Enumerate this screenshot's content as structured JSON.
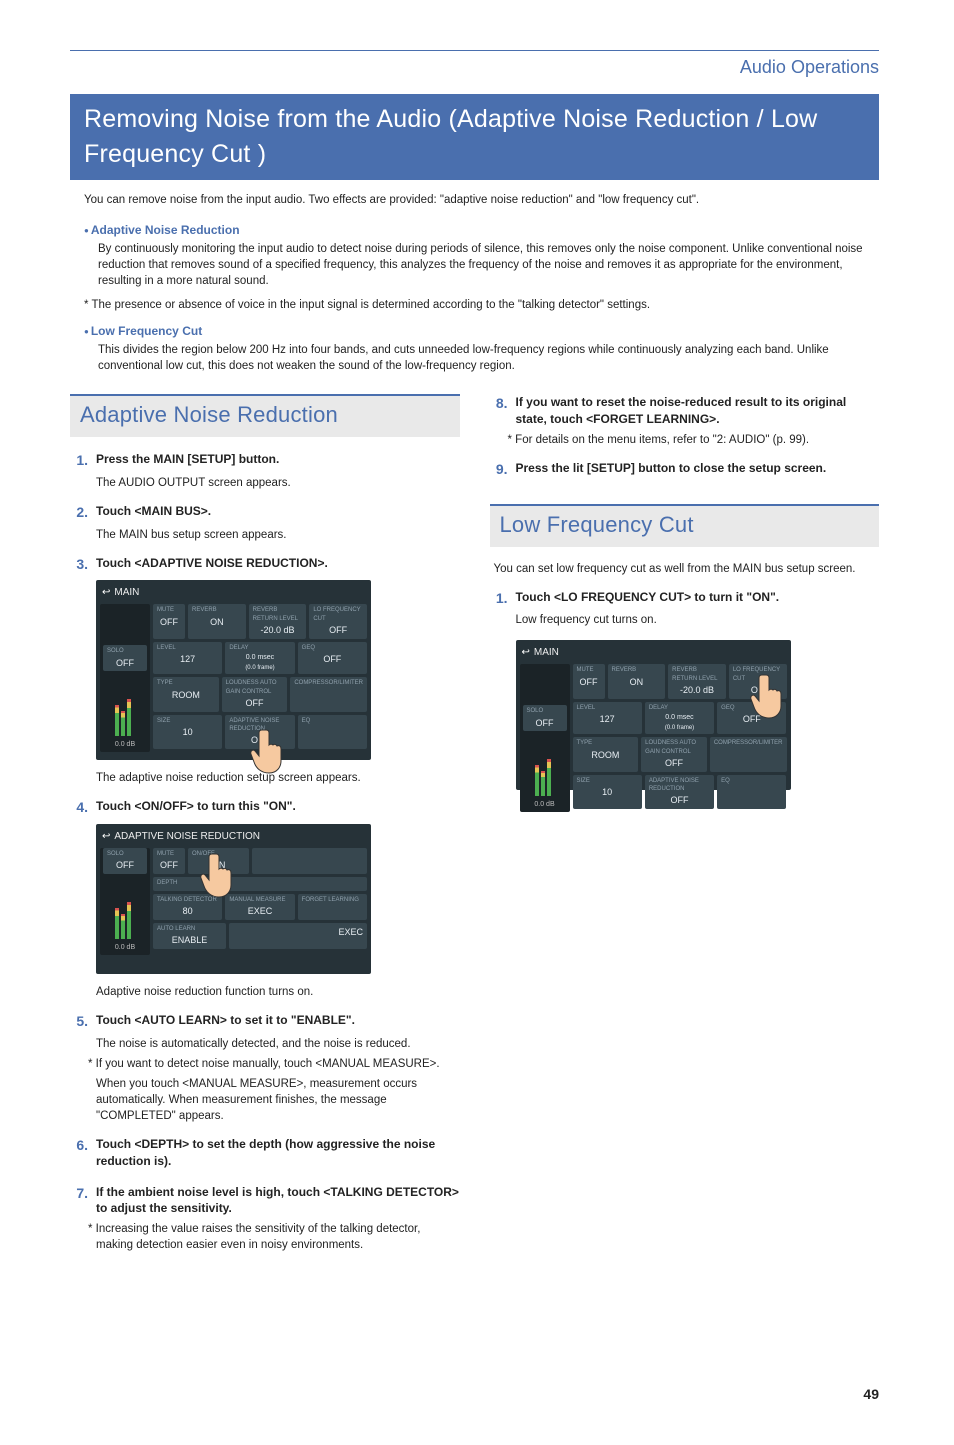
{
  "header": {
    "category": "Audio Operations"
  },
  "page_title": "Removing Noise from the Audio (Adaptive Noise Reduction / Low Frequency Cut )",
  "intro": "You can remove noise from the input audio. Two effects are provided: \"adaptive noise reduction\" and \"low frequency cut\".",
  "feature1": {
    "title": "Adaptive Noise Reduction",
    "body": "By continuously monitoring the input audio to detect noise during periods of silence, this removes only the noise component. Unlike conventional noise reduction that removes sound of a specified frequency, this analyzes the frequency of the noise and removes it as appropriate for the environment, resulting in a more natural sound.",
    "star": "The presence or absence of voice in the input signal is determined according to the \"talking detector\" settings."
  },
  "feature2": {
    "title": "Low Frequency Cut",
    "body": "This divides the region below 200 Hz into four bands, and cuts unneeded low-frequency regions while continuously analyzing each band. Unlike conventional low cut, this does not weaken the sound of the low-frequency region."
  },
  "anr_section": {
    "title": "Adaptive Noise Reduction",
    "step1": {
      "text": "Press the MAIN [SETUP] button.",
      "sub": "The AUDIO OUTPUT screen appears."
    },
    "step2": {
      "text": "Touch <MAIN BUS>.",
      "sub": "The MAIN bus setup screen appears."
    },
    "step3": {
      "text": "Touch <ADAPTIVE NOISE REDUCTION>.",
      "sub": "The adaptive noise reduction setup screen appears."
    },
    "step4": {
      "text": "Touch <ON/OFF> to turn this \"ON\".",
      "sub": "Adaptive noise reduction function turns on."
    },
    "step5": {
      "text": "Touch <AUTO LEARN> to set it to \"ENABLE\".",
      "sub": "The noise is automatically detected, and the noise is reduced.",
      "star": "If you want to detect noise manually, touch <MANUAL MEASURE>.",
      "after": "When you touch <MANUAL MEASURE>, measurement occurs automatically. When measurement finishes, the message \"COMPLETED\" appears."
    },
    "step6": {
      "text": "Touch <DEPTH> to set the depth (how aggressive the noise reduction is)."
    },
    "step7": {
      "text": "If the ambient noise level is high, touch <TALKING DETECTOR> to adjust the sensitivity.",
      "star": "Increasing the value raises the sensitivity of the talking detector, making detection easier even in noisy environments."
    },
    "step8": {
      "text": "If you want to reset the noise-reduced result to its original state, touch <FORGET LEARNING>.",
      "star": "For details on the menu items, refer to \"2: AUDIO\" (p. 99)."
    },
    "step9": {
      "text": "Press the lit [SETUP] button to close the setup screen."
    }
  },
  "lfc_section": {
    "title": "Low Frequency Cut",
    "intro": "You can set low frequency cut as well from the MAIN bus setup screen.",
    "step1": {
      "text": "Touch <LO FREQUENCY CUT> to turn it \"ON\".",
      "sub": "Low frequency cut turns on."
    }
  },
  "ui_main": {
    "title": "MAIN",
    "cells": {
      "solo_lbl": "SOLO",
      "solo": "OFF",
      "mute_lbl": "MUTE",
      "mute": "OFF",
      "reverb_lbl": "REVERB",
      "reverb": "ON",
      "return_lbl": "REVERB RETURN LEVEL",
      "return": "-20.0 dB",
      "lofreq_lbl": "LO FREQUENCY CUT",
      "lofreq": "OFF",
      "level_lbl": "LEVEL",
      "level": "127",
      "delay_lbl": "DELAY",
      "delay_a": "0.0 msec",
      "delay_b": "(0.0 frame)",
      "geq_lbl": "GEQ",
      "geq": "OFF",
      "type_lbl": "TYPE",
      "type": "ROOM",
      "loud_lbl": "LOUDNESS AUTO GAIN CONTROL",
      "loud": "OFF",
      "comp_lbl": "COMPRESSOR/LIMITER",
      "size_lbl": "SIZE",
      "size": "10",
      "anr_lbl": "ADAPTIVE NOISE REDUCTION",
      "anr": "OFF",
      "eq_lbl": "EQ",
      "db": "0.0 dB"
    }
  },
  "ui_anr": {
    "title": "ADAPTIVE NOISE REDUCTION",
    "cells": {
      "solo_lbl": "SOLO",
      "solo": "OFF",
      "mute_lbl": "MUTE",
      "mute": "OFF",
      "onoff_lbl": "ON/OFF",
      "onoff": "ON",
      "depth_lbl": "DEPTH",
      "talking_lbl": "TALKING DETECTOR",
      "talking": "80",
      "measure_lbl": "MANUAL MEASURE",
      "measure": "EXEC",
      "auto_lbl": "AUTO LEARN",
      "auto": "ENABLE",
      "forget_lbl": "FORGET LEARNING",
      "forget": "EXEC",
      "db": "0.0 dB"
    }
  },
  "page_number": "49"
}
